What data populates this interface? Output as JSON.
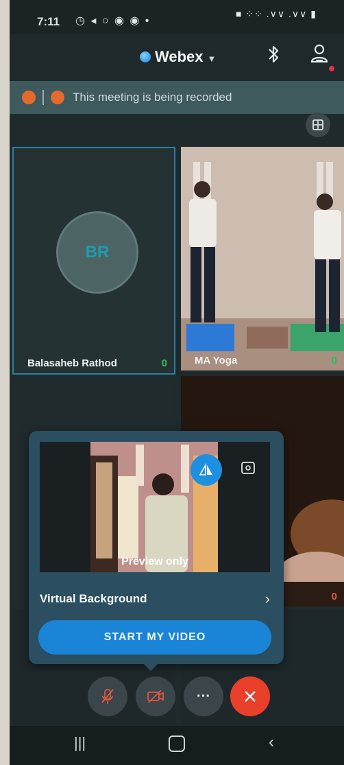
{
  "status_bar": {
    "time": "7:11",
    "icons_left": "◷ ◂ ○ ◉ ◉ •",
    "icons_right": "■ ⁘⁘ .∨∨ .∨∨ ▮"
  },
  "header": {
    "app_name": "Webex",
    "bluetooth_icon": "bluetooth-icon",
    "participants_icon": "person-icon"
  },
  "recording": {
    "text": "This meeting is being recorded",
    "color": "#e36a2c"
  },
  "tiles": [
    {
      "name": "Balasaheb Rathod",
      "initials": "BR",
      "mic": "0"
    },
    {
      "name": "MA Yoga",
      "mic": "0"
    },
    {
      "name": ""
    },
    {
      "name": "",
      "mic": "0"
    }
  ],
  "preview_card": {
    "preview_label": "Preview only",
    "virtual_background_label": "Virtual Background",
    "start_video_label": "START MY VIDEO"
  },
  "controls": {
    "more_label": "···"
  },
  "colors": {
    "accent_blue": "#1a84d6",
    "leave_red": "#e8402a",
    "mic_green": "#28c15a"
  }
}
